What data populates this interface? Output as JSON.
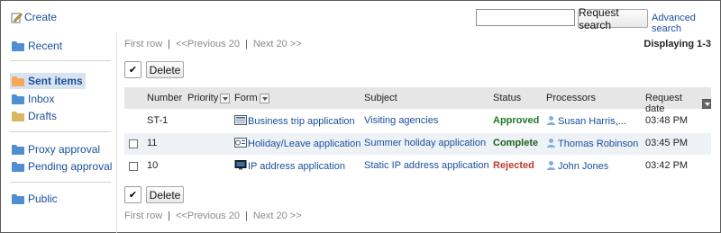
{
  "toolbar": {
    "create_label": "Create",
    "search_value": "",
    "search_button": "Request search",
    "advanced_search": "Advanced search"
  },
  "sidebar": {
    "items": [
      {
        "label": "Recent",
        "icon": "folder-icon"
      },
      {
        "label": "Sent items",
        "icon": "open-folder-icon",
        "active": true
      },
      {
        "label": "Inbox",
        "icon": "folder-icon"
      },
      {
        "label": "Drafts",
        "icon": "folder-icon"
      },
      {
        "label": "Proxy approval",
        "icon": "folder-icon"
      },
      {
        "label": "Pending approval",
        "icon": "folder-icon"
      },
      {
        "label": "Public",
        "icon": "folder-icon"
      }
    ]
  },
  "pager": {
    "first": "First row",
    "separator": "|",
    "prev": "<<Previous 20",
    "next": "Next 20 >>",
    "displaying": "Displaying 1-3"
  },
  "actions": {
    "check_all": "✔",
    "delete": "Delete"
  },
  "table": {
    "headers": {
      "number": "Number",
      "priority": "Priority",
      "form": "Form",
      "subject": "Subject",
      "status": "Status",
      "processors": "Processors",
      "request_date": "Request date"
    },
    "rows": [
      {
        "number": "ST-1",
        "form": "Business trip application",
        "subject": "Visiting agencies",
        "status": "Approved",
        "processors": "Susan Harris",
        "more": ",...",
        "date": "03:48 PM",
        "has_checkbox": false
      },
      {
        "number": "11",
        "form": "Holiday/Leave application",
        "subject": "Summer holiday application",
        "status": "Complete",
        "processors": "Thomas Robinson",
        "more": "",
        "date": "03:45 PM",
        "has_checkbox": true
      },
      {
        "number": "10",
        "form": "IP address application",
        "subject": "Static IP address application",
        "status": "Rejected",
        "processors": "John Jones",
        "more": "",
        "date": "03:42 PM",
        "has_checkbox": true
      }
    ]
  },
  "colors": {
    "link": "#1a4f9c",
    "approved": "#1f7a2a",
    "complete": "#1f5f1f",
    "rejected": "#c0392b",
    "header_bg": "#e6e6e6",
    "alt_row_bg": "#eef2f7",
    "active_sidebar_bg": "#d9e3f0"
  }
}
